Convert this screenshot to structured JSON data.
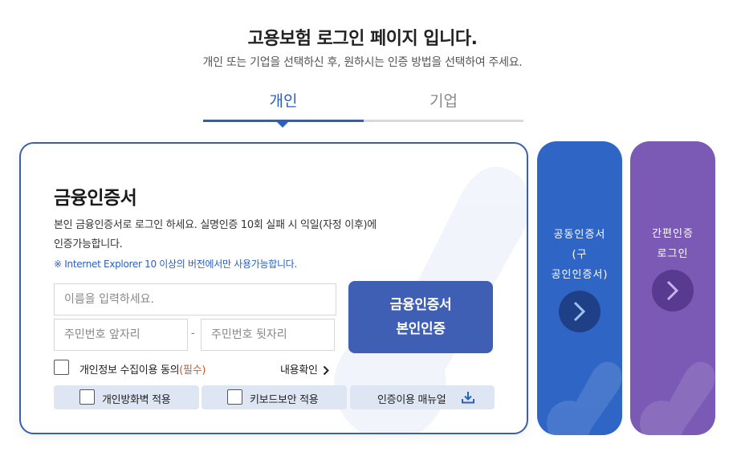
{
  "header": {
    "title": "고용보험 로그인 페이지 입니다.",
    "subtitle": "개인 또는 기업을 선택하신 후, 원하시는 인증 방법을 선택하여 주세요."
  },
  "tabs": [
    {
      "label": "개인",
      "active": true
    },
    {
      "label": "기업",
      "active": false
    }
  ],
  "main_card": {
    "title": "금융인증서",
    "desc_line1": "본인 금융인증서로 로그인 하세요. 실명인증 10회 실패 시 익일(자정 이후)에",
    "desc_line2": "인증가능합니다.",
    "note": "※ Internet Explorer 10 이상의 버전에서만 사용가능합니다.",
    "name_placeholder": "이름을 입력하세요.",
    "rrn_front_placeholder": "주민번호 앞자리",
    "rrn_back_placeholder": "주민번호 뒷자리",
    "rrn_separator": "-",
    "auth_button_line1": "금융인증서",
    "auth_button_line2": "본인인증",
    "consent_label": "개인정보 수집이용 동의",
    "consent_required": "(필수)",
    "consent_view": "내용확인",
    "firewall_label": "개인방화벽 적용",
    "keyboard_label": "키보드보안 적용",
    "manual_label": "인증이용 매뉴얼"
  },
  "side_cards": {
    "joint": {
      "line1": "공동인증서",
      "line2": "(구",
      "line3": "공인인증서)"
    },
    "simple": {
      "line1": "간편인증",
      "line2": "로그인"
    }
  },
  "colors": {
    "accent_blue": "#2b5fbf",
    "auth_button": "#3f5fb4",
    "joint_card": "#2f66c6",
    "simple_card": "#7a5ab4",
    "required_text": "#d4572a",
    "option_bar": "#dfe6f3"
  },
  "icons": {
    "consent_view": "chevron-right-icon",
    "manual": "download-icon",
    "side_cards": "chevron-right-icon"
  }
}
